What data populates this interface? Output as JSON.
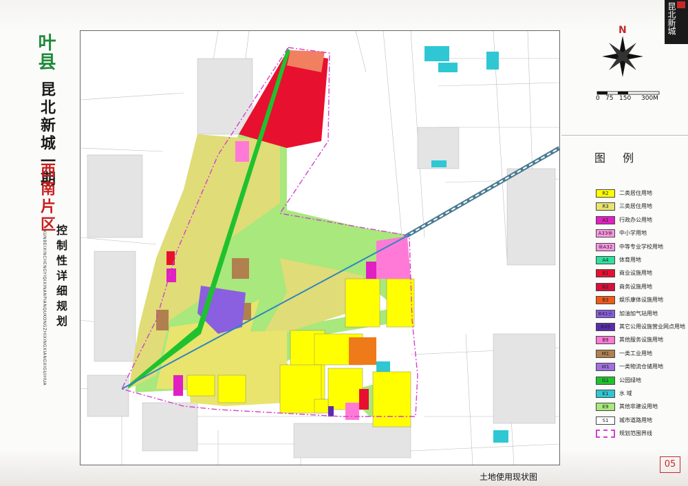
{
  "title": {
    "county": "叶县",
    "district": "昆北新城一期",
    "area": "西南片区",
    "plan_type": "控制性详细规划",
    "pinyin": "KUNBEIXINCHENGYIQIXINANPIANQUKONGZHIXINGXIANGXIGUIHUA"
  },
  "seal": {
    "text": "昆北新城"
  },
  "compass": {
    "north": "N"
  },
  "scale": {
    "ticks": [
      "0",
      "75",
      "150",
      "300M"
    ]
  },
  "legend": {
    "title": "图 例",
    "items": [
      {
        "code": "R2",
        "label": "二类居住用地",
        "color": "#ffff00"
      },
      {
        "code": "R3",
        "label": "三类居住用地",
        "color": "#e8e46e"
      },
      {
        "code": "A1",
        "label": "行政办公用地",
        "color": "#e020c0"
      },
      {
        "code": "A33㊥",
        "label": "中小学用地",
        "color": "#ff99e6"
      },
      {
        "code": "㊥A32",
        "label": "中等专业学校用地",
        "color": "#ff99e6"
      },
      {
        "code": "A4",
        "label": "体育用地",
        "color": "#2ee0a0"
      },
      {
        "code": "B1",
        "label": "商业设施用地",
        "color": "#e8102f"
      },
      {
        "code": "B2",
        "label": "商务设施用地",
        "color": "#d8103c"
      },
      {
        "code": "B3",
        "label": "娱乐康体设施用地",
        "color": "#ee5a1a"
      },
      {
        "code": "B41㊉",
        "label": "加油加气站用地",
        "color": "#8a5fe0"
      },
      {
        "code": "B49",
        "label": "其它公用设施营业网点用地",
        "color": "#5a2bb0"
      },
      {
        "code": "B9",
        "label": "其他服务设施用地",
        "color": "#ff7ad6"
      },
      {
        "code": "M1",
        "label": "一类工业用地",
        "color": "#b0804e"
      },
      {
        "code": "W1",
        "label": "一类物流仓储用地",
        "color": "#a070e0"
      },
      {
        "code": "G1",
        "label": "公园绿地",
        "color": "#1fc22e"
      },
      {
        "code": "E1",
        "label": "水 域",
        "color": "#2ec7d3"
      },
      {
        "code": "E9",
        "label": "其他非建设用地",
        "color": "#a8e87c"
      },
      {
        "code": "S1",
        "label": "城市道路用地",
        "color": "#ffffff"
      },
      {
        "code": "",
        "label": "规划范围界线",
        "color": "#d43fd0"
      }
    ]
  },
  "map_title": "土地使用现状图",
  "page_number": "05"
}
